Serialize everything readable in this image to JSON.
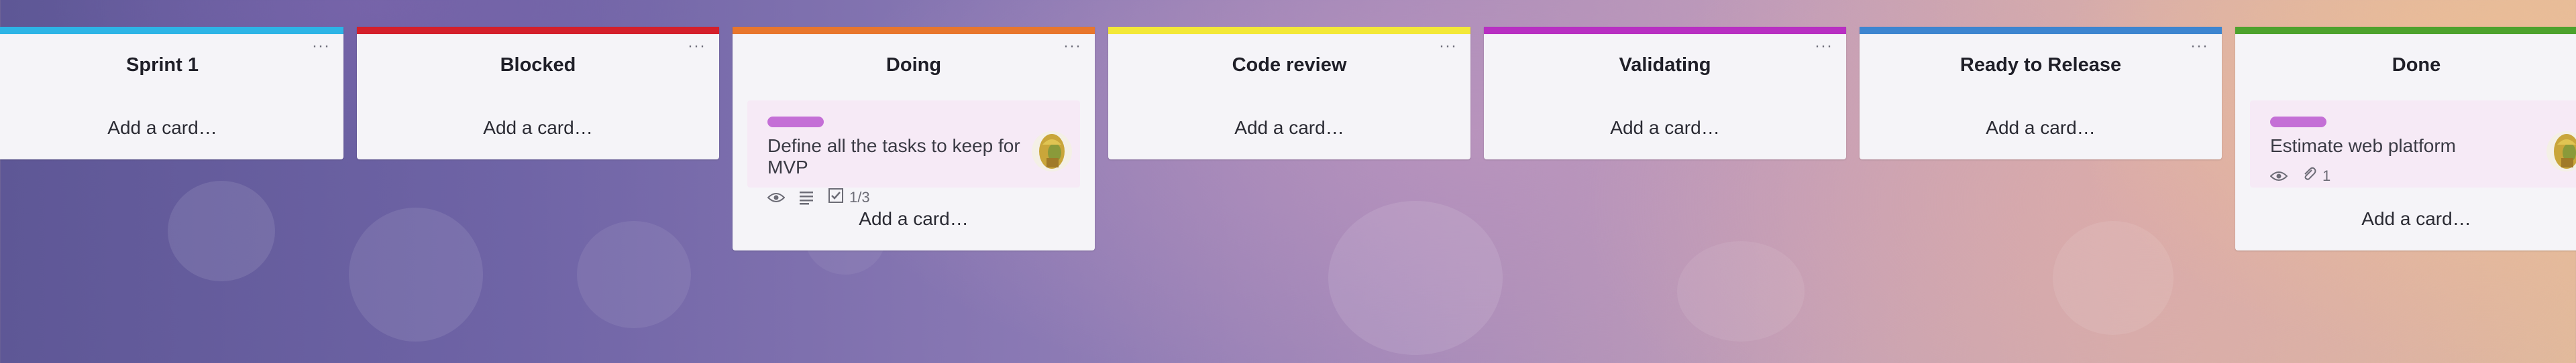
{
  "lists": [
    {
      "title": "Sprint 1",
      "menu": "···",
      "add_card": "Add a card…",
      "stripe_color": "#2db4e6"
    },
    {
      "title": "Blocked",
      "menu": "···",
      "add_card": "Add a card…",
      "stripe_color": "#d41f2b"
    },
    {
      "title": "Doing",
      "menu": "···",
      "add_card": "Add a card…",
      "stripe_color": "#e8762d",
      "card": {
        "title": "Define all the tasks to keep for MVP",
        "label_color": "#c46fd6",
        "checklist": "1/3"
      }
    },
    {
      "title": "Code review",
      "menu": "···",
      "add_card": "Add a card…",
      "stripe_color": "#f3e838"
    },
    {
      "title": "Validating",
      "menu": "···",
      "add_card": "Add a card…",
      "stripe_color": "#b82fc2"
    },
    {
      "title": "Ready to Release",
      "menu": "···",
      "add_card": "Add a card…",
      "stripe_color": "#3d85d0"
    },
    {
      "title": "Done",
      "menu": "···",
      "add_card": "Add a card…",
      "stripe_color": "#4da22d",
      "card": {
        "title": "Estimate web platform",
        "label_color": "#c46fd6",
        "attachments": "1"
      }
    }
  ],
  "icons": {
    "watch": "eye-icon",
    "description": "description-icon",
    "checklist": "checklist-icon",
    "attachment": "paperclip-icon",
    "avatar": "member-avatar"
  }
}
